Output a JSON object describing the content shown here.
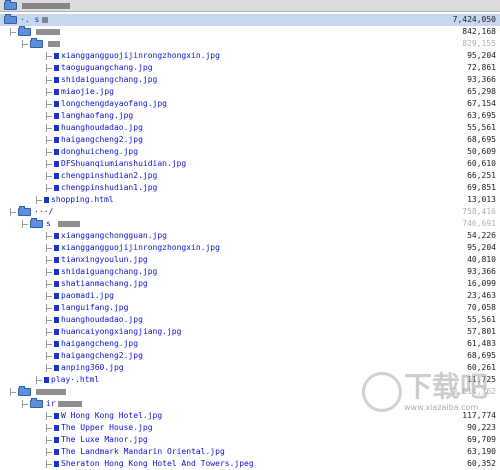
{
  "rows": [
    {
      "depth": 0,
      "kind": "folder",
      "name": "",
      "redact": 48,
      "size": "",
      "type": "header"
    },
    {
      "depth": 0,
      "kind": "folder",
      "name": "·. s",
      "redact": 6,
      "size": "7,424,050",
      "type": "sel"
    },
    {
      "depth": 1,
      "kind": "folder",
      "name": "",
      "redact": 24,
      "size": "842,168",
      "type": ""
    },
    {
      "depth": 2,
      "kind": "folder",
      "name": "",
      "redact": 12,
      "size": "829,155",
      "type": "dim"
    },
    {
      "depth": 3,
      "kind": "file",
      "name": "xianggangguojijinrongzhongxin.jpg",
      "size": "95,204"
    },
    {
      "depth": 3,
      "kind": "file",
      "name": "taoguguangchang.jpg",
      "size": "72,861"
    },
    {
      "depth": 3,
      "kind": "file",
      "name": "shidaiguangchang.jpg",
      "size": "93,366"
    },
    {
      "depth": 3,
      "kind": "file",
      "name": "miaojie.jpg",
      "size": "65,298"
    },
    {
      "depth": 3,
      "kind": "file",
      "name": "longchengdayaofang.jpg",
      "size": "67,154"
    },
    {
      "depth": 3,
      "kind": "file",
      "name": "langhaofang.jpg",
      "size": "63,695"
    },
    {
      "depth": 3,
      "kind": "file",
      "name": "huanghoudadao.jpg",
      "size": "55,561"
    },
    {
      "depth": 3,
      "kind": "file",
      "name": "haigangcheng2.jpg",
      "size": "68,695"
    },
    {
      "depth": 3,
      "kind": "file",
      "name": "donghuicheng.jpg",
      "size": "50,609"
    },
    {
      "depth": 3,
      "kind": "file",
      "name": "DFShuanqiumianshuidian.jpg",
      "size": "60,610"
    },
    {
      "depth": 3,
      "kind": "file",
      "name": "chengpinshudian2.jpg",
      "size": "66,251"
    },
    {
      "depth": 3,
      "kind": "file",
      "name": "chengpinshudian1.jpg",
      "size": "69,851"
    },
    {
      "depth": 2,
      "kind": "file",
      "name": "shopping.html",
      "size": "13,013"
    },
    {
      "depth": 1,
      "kind": "folder",
      "name": "···/",
      "redact": 0,
      "size": "758,416",
      "type": "dim"
    },
    {
      "depth": 2,
      "kind": "folder",
      "name": " s",
      "redact": 22,
      "size": "746,691",
      "type": "dim"
    },
    {
      "depth": 3,
      "kind": "file",
      "name": "xianggangchongguan.jpg",
      "size": "54,226"
    },
    {
      "depth": 3,
      "kind": "file",
      "name": "xianggangguojijinrongzhongxin.jpg",
      "size": "95,204"
    },
    {
      "depth": 3,
      "kind": "file",
      "name": "tianxingyoulun.jpg",
      "size": "40,810"
    },
    {
      "depth": 3,
      "kind": "file",
      "name": "shidaiguangchang.jpg",
      "size": "93,366"
    },
    {
      "depth": 3,
      "kind": "file",
      "name": "shatianmachang.jpg",
      "size": "16,099"
    },
    {
      "depth": 3,
      "kind": "file",
      "name": "paomadi.jpg",
      "size": "23,463"
    },
    {
      "depth": 3,
      "kind": "file",
      "name": "languifang.jpg",
      "size": "70,058"
    },
    {
      "depth": 3,
      "kind": "file",
      "name": "huanghoudadao.jpg",
      "size": "55,561"
    },
    {
      "depth": 3,
      "kind": "file",
      "name": "huancaiyongxiangjiang.jpg",
      "size": "57,801"
    },
    {
      "depth": 3,
      "kind": "file",
      "name": "haigangcheng.jpg",
      "size": "61,483"
    },
    {
      "depth": 3,
      "kind": "file",
      "name": "haigangcheng2.jpg",
      "size": "68,695"
    },
    {
      "depth": 3,
      "kind": "file",
      "name": "anping360.jpg",
      "size": "60,261"
    },
    {
      "depth": 2,
      "kind": "file",
      "name": "play·.html",
      "size": "11,725"
    },
    {
      "depth": 1,
      "kind": "folder",
      "name": "",
      "redact": 30,
      "size": "2,014,362",
      "type": "dim"
    },
    {
      "depth": 2,
      "kind": "folder",
      "name": "ir",
      "redact": 24,
      "size": "",
      "type": ""
    },
    {
      "depth": 3,
      "kind": "file",
      "name": "W Hong Kong Hotel.jpg",
      "size": "117,774"
    },
    {
      "depth": 3,
      "kind": "file",
      "name": "The Upper House.jpg",
      "size": "90,223"
    },
    {
      "depth": 3,
      "kind": "file",
      "name": "The Luxe Manor.jpg",
      "size": "69,709"
    },
    {
      "depth": 3,
      "kind": "file",
      "name": "The Landmark Mandarin Oriental.jpg",
      "size": "63,190"
    },
    {
      "depth": 3,
      "kind": "file",
      "name": "Sheraton Hong Kong Hotel And Towers.jpeg",
      "size": "60,352"
    }
  ],
  "watermark": {
    "text": "下载吧",
    "url": "www.xiazaiba.com"
  }
}
